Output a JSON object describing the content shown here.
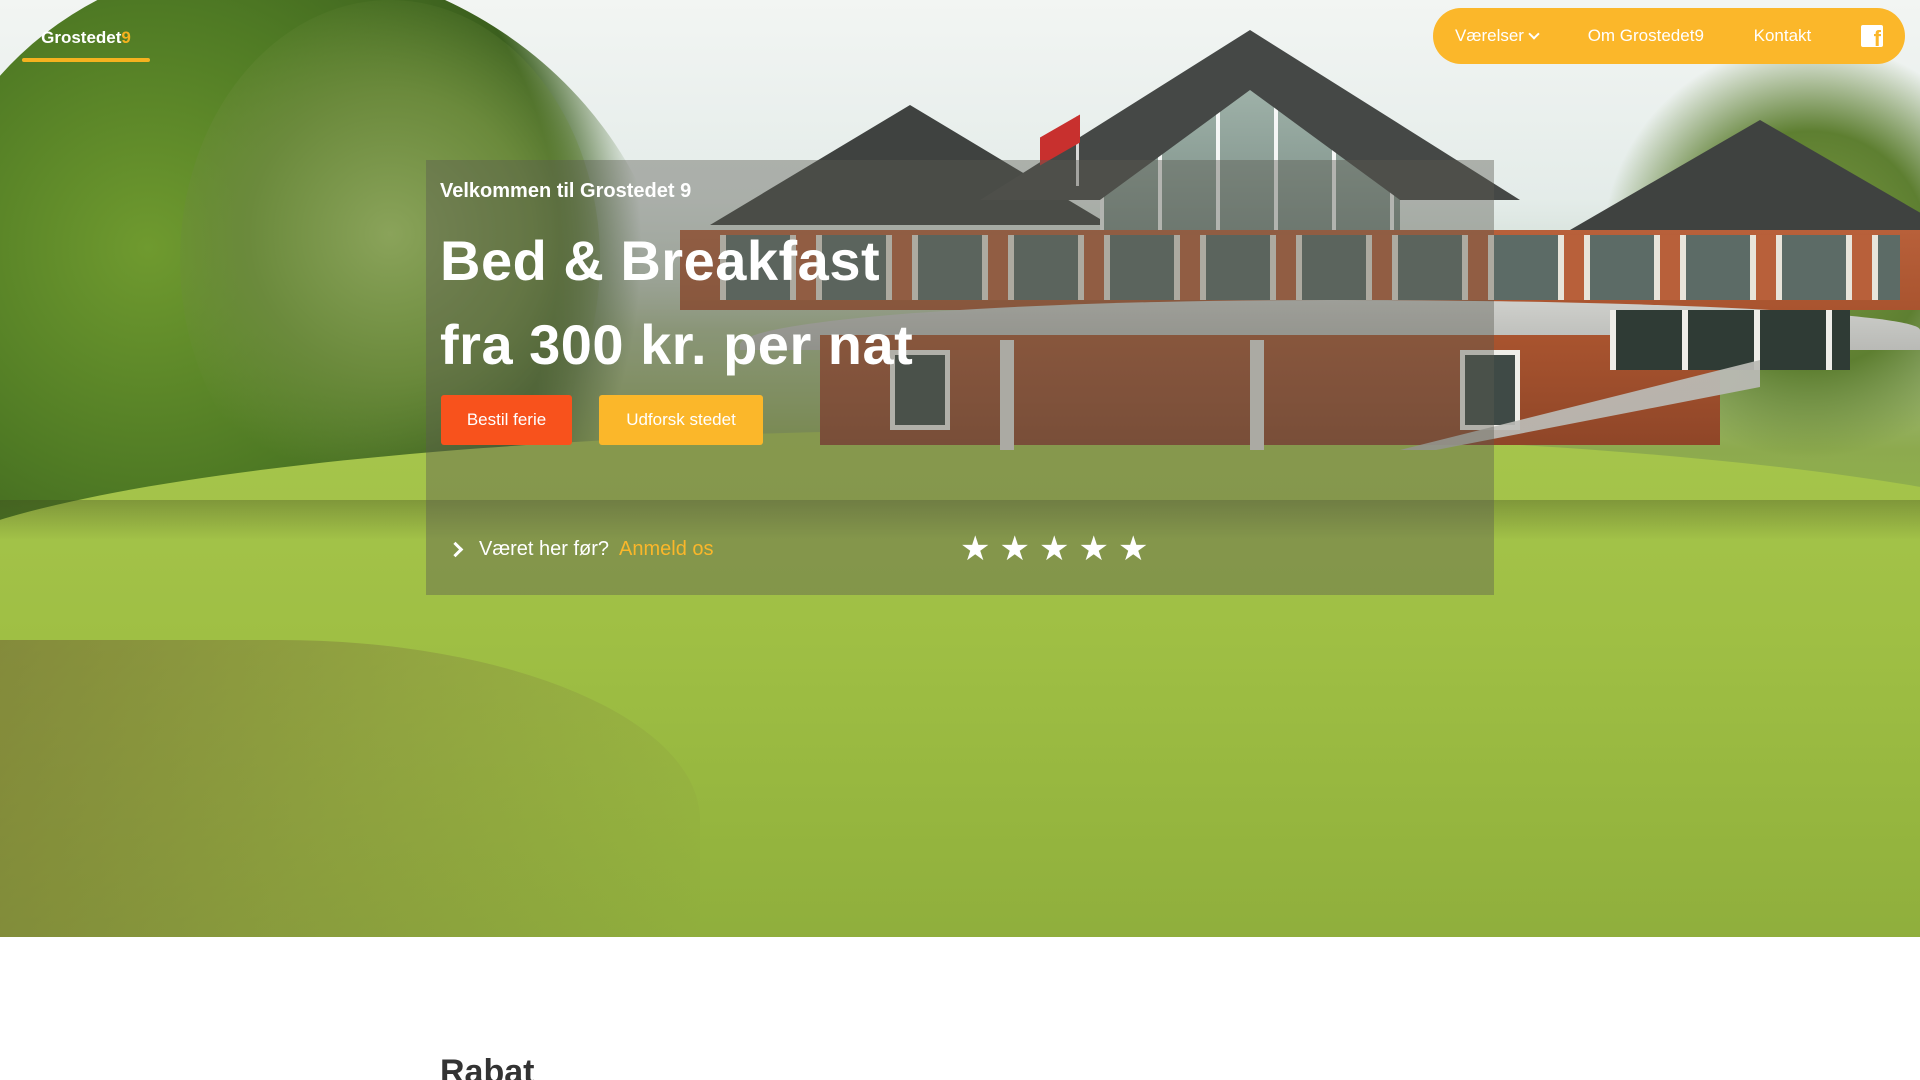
{
  "header": {
    "logo_text": "Grostedet",
    "logo_number": "9",
    "nav": {
      "rooms_label": "Værelser",
      "about_label": "Om Grostedet9",
      "contact_label": "Kontakt",
      "social_icon": "facebook-icon"
    }
  },
  "hero": {
    "welcome": "Velkommen til Grostedet 9",
    "headline_line1": "Bed & Breakfast",
    "headline_line2": "fra 300 kr. per nat",
    "book_button": "Bestil ferie",
    "explore_button": "Udforsk stedet",
    "review_prompt": "Været her før?",
    "review_link": "Anmeld os",
    "rating_stars": 5
  },
  "section": {
    "title": "Rabat"
  },
  "colors": {
    "accent": "#fbb72a",
    "cta": "#f8521c",
    "text_dark": "#333333"
  }
}
